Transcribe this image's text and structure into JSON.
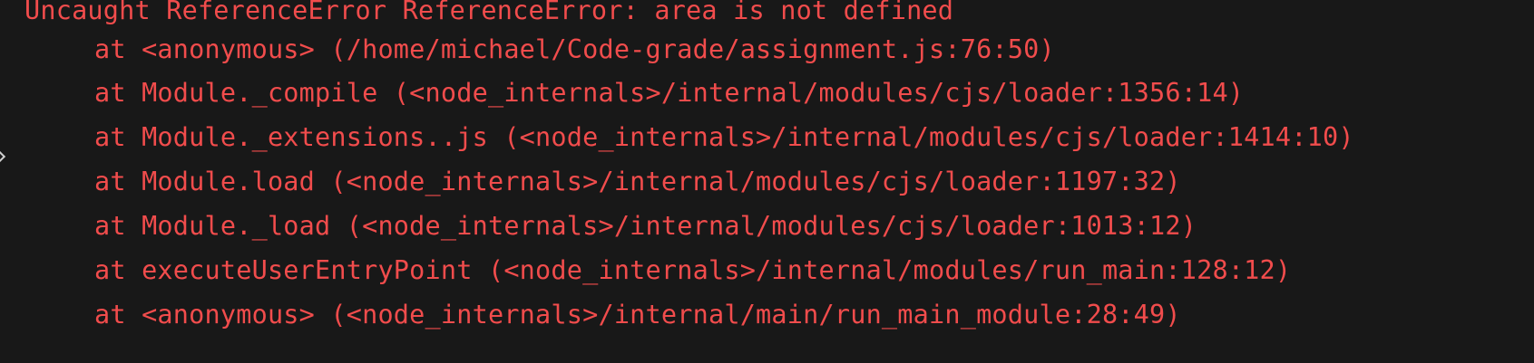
{
  "console": {
    "error_message": "Uncaught ReferenceError ReferenceError: area is not defined",
    "stack": [
      "at <anonymous> (/home/michael/Code-grade/assignment.js:76:50)",
      "at Module._compile (<node_internals>/internal/modules/cjs/loader:1356:14)",
      "at Module._extensions..js (<node_internals>/internal/modules/cjs/loader:1414:10)",
      "at Module.load (<node_internals>/internal/modules/cjs/loader:1197:32)",
      "at Module._load (<node_internals>/internal/modules/cjs/loader:1013:12)",
      "at executeUserEntryPoint (<node_internals>/internal/modules/run_main:128:12)",
      "at <anonymous> (<node_internals>/internal/main/run_main_module:28:49)"
    ],
    "colors": {
      "background": "#181818",
      "error_text": "#f14c4c",
      "chevron": "#cfcfcf"
    },
    "icons": {
      "expand": "chevron-right-icon"
    }
  }
}
